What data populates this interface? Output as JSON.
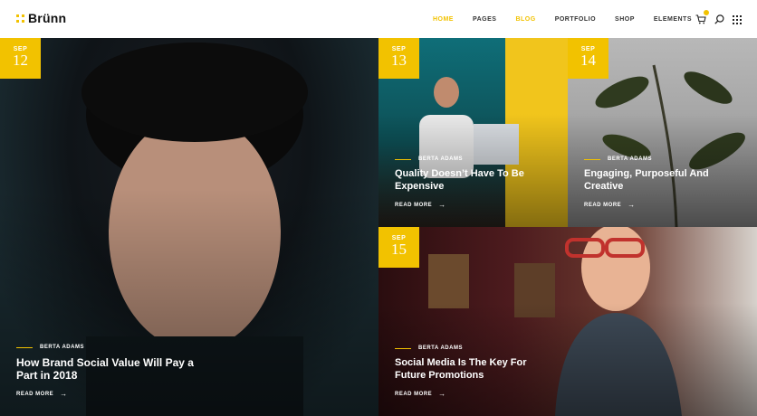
{
  "brand": {
    "logo_text": "Brünn",
    "accent": "#f2c200"
  },
  "nav": [
    {
      "label": "HOME",
      "active": true
    },
    {
      "label": "PAGES",
      "active": false
    },
    {
      "label": "BLOG",
      "active": true
    },
    {
      "label": "PORTFOLIO",
      "active": false
    },
    {
      "label": "SHOP",
      "active": false
    },
    {
      "label": "ELEMENTS",
      "active": false
    }
  ],
  "icons": [
    "cart-icon",
    "search-icon",
    "grid-menu-icon"
  ],
  "posts": [
    {
      "month": "SEP",
      "day": "12",
      "author": "BERTA ADAMS",
      "title": "How Brand Social Value Will Pay a Part in 2018",
      "read_more": "READ MORE"
    },
    {
      "month": "SEP",
      "day": "13",
      "author": "BERTA ADAMS",
      "title": "Quality Doesn’t Have To Be Expensive",
      "read_more": "READ MORE"
    },
    {
      "month": "SEP",
      "day": "14",
      "author": "BERTA ADAMS",
      "title": "Engaging, Purposeful And Creative",
      "read_more": "READ MORE"
    },
    {
      "month": "SEP",
      "day": "15",
      "author": "BERTA ADAMS",
      "title": "Social Media Is The Key For Future Promotions",
      "read_more": "READ MORE"
    }
  ]
}
